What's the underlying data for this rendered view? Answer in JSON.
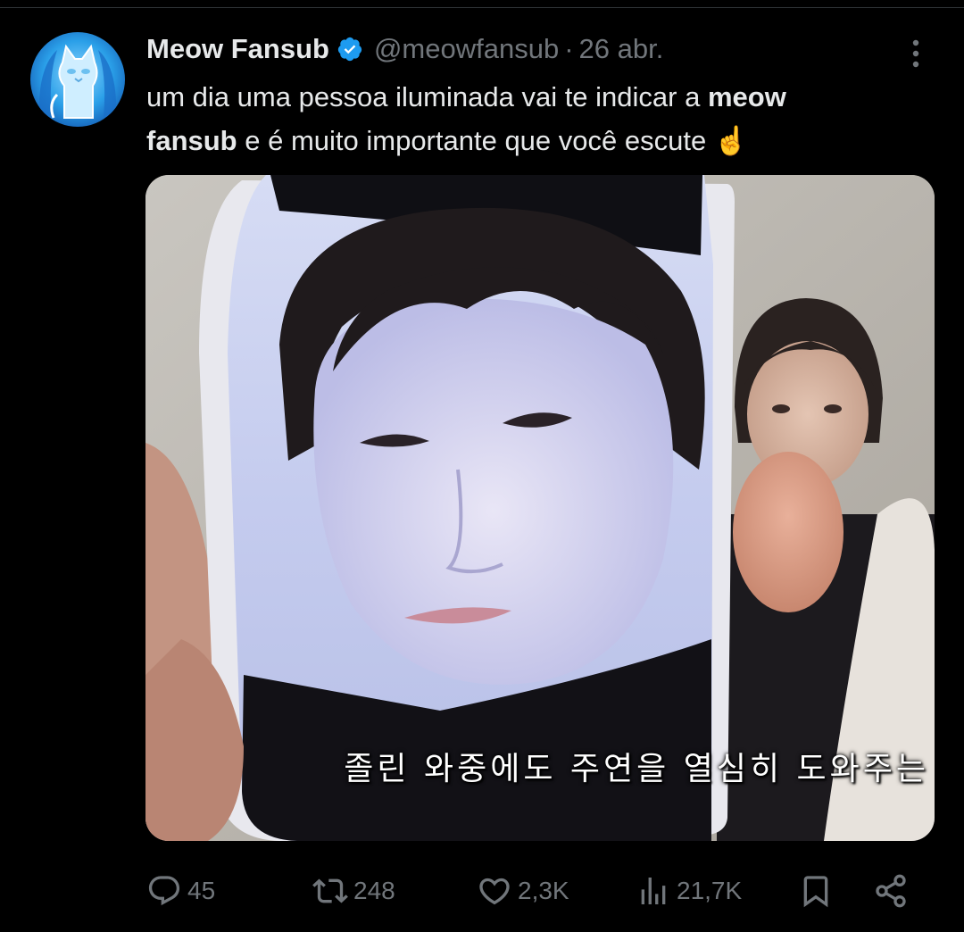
{
  "author": {
    "display_name": "Meow Fansub",
    "handle": "@meowfansub",
    "date_separator": "·",
    "date": "26 abr."
  },
  "tweet": {
    "text_part1": "um dia uma pessoa iluminada vai te indicar a ",
    "text_bold_1": "meow",
    "text_bold_2": "fansub",
    "text_part2": " e é muito importante que você escute ",
    "emoji": "☝️"
  },
  "media": {
    "subtitle": "졸린 와중에도 주연을 열심히 도와주는"
  },
  "actions": {
    "replies": "45",
    "reposts": "248",
    "likes": "2,3K",
    "views": "21,7K"
  },
  "colors": {
    "background": "#000000",
    "text_primary": "#e7e9ea",
    "text_secondary": "#71767b",
    "verified_badge": "#1d9bf0",
    "divider": "#2f3336"
  },
  "icons": {
    "reply": "speech-bubble-icon",
    "repost": "repost-arrows-icon",
    "like": "heart-icon",
    "views": "bar-chart-icon",
    "bookmark": "bookmark-icon",
    "share": "share-icon",
    "more": "three-dots-vertical-icon",
    "verified": "verified-badge-icon"
  }
}
